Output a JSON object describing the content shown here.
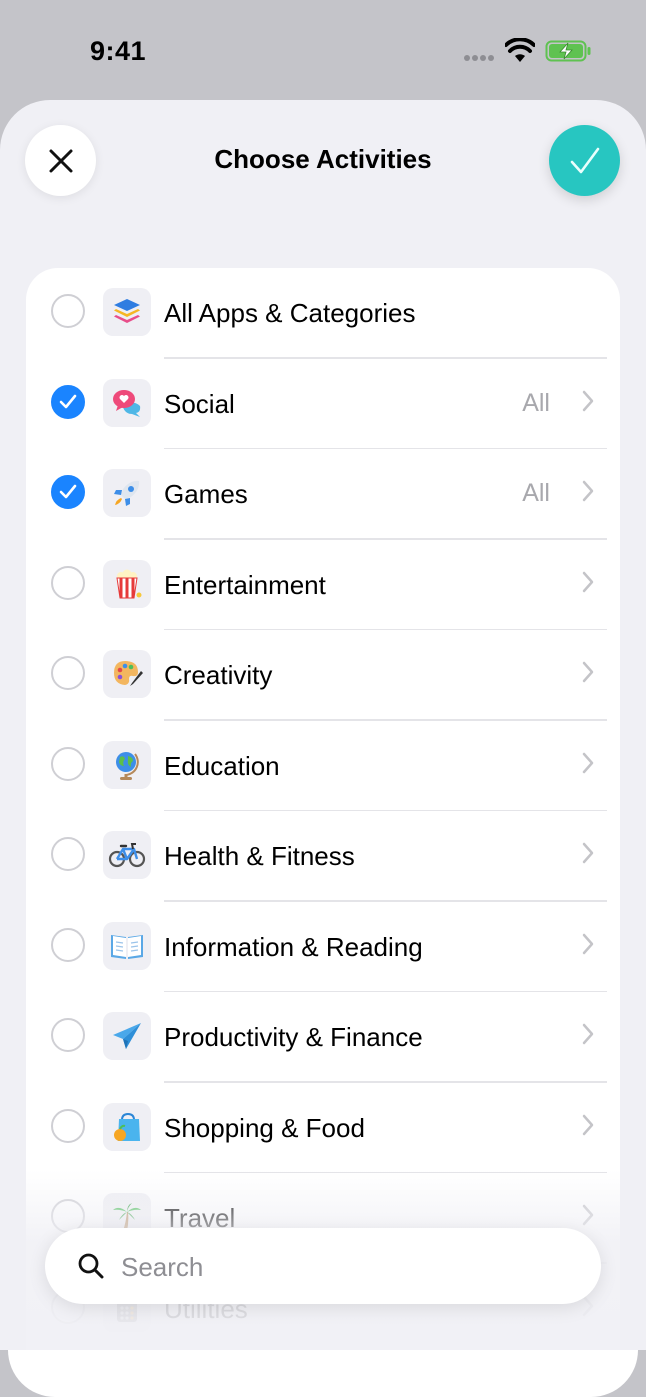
{
  "status_bar": {
    "time": "9:41"
  },
  "header": {
    "title": "Choose Activities"
  },
  "categories": [
    {
      "label": "All Apps & Categories",
      "detail": "",
      "checked": false,
      "icon": "stack-icon"
    },
    {
      "label": "Social",
      "detail": "All",
      "checked": true,
      "icon": "speech-bubbles-icon"
    },
    {
      "label": "Games",
      "detail": "All",
      "checked": true,
      "icon": "rocket-icon"
    },
    {
      "label": "Entertainment",
      "detail": "",
      "checked": false,
      "icon": "popcorn-icon"
    },
    {
      "label": "Creativity",
      "detail": "",
      "checked": false,
      "icon": "palette-icon"
    },
    {
      "label": "Education",
      "detail": "",
      "checked": false,
      "icon": "globe-icon"
    },
    {
      "label": "Health & Fitness",
      "detail": "",
      "checked": false,
      "icon": "bicycle-icon"
    },
    {
      "label": "Information & Reading",
      "detail": "",
      "checked": false,
      "icon": "book-icon"
    },
    {
      "label": "Productivity & Finance",
      "detail": "",
      "checked": false,
      "icon": "paper-plane-icon"
    },
    {
      "label": "Shopping & Food",
      "detail": "",
      "checked": false,
      "icon": "shopping-bag-icon"
    },
    {
      "label": "Travel",
      "detail": "",
      "checked": false,
      "icon": "palm-tree-icon"
    },
    {
      "label": "Utilities",
      "detail": "",
      "checked": false,
      "icon": "calculator-icon"
    }
  ],
  "search": {
    "placeholder": "Search",
    "value": ""
  },
  "colors": {
    "accent": "#27c6c1",
    "checkbox": "#1a84ff",
    "sheet": "#f0f0f5"
  }
}
